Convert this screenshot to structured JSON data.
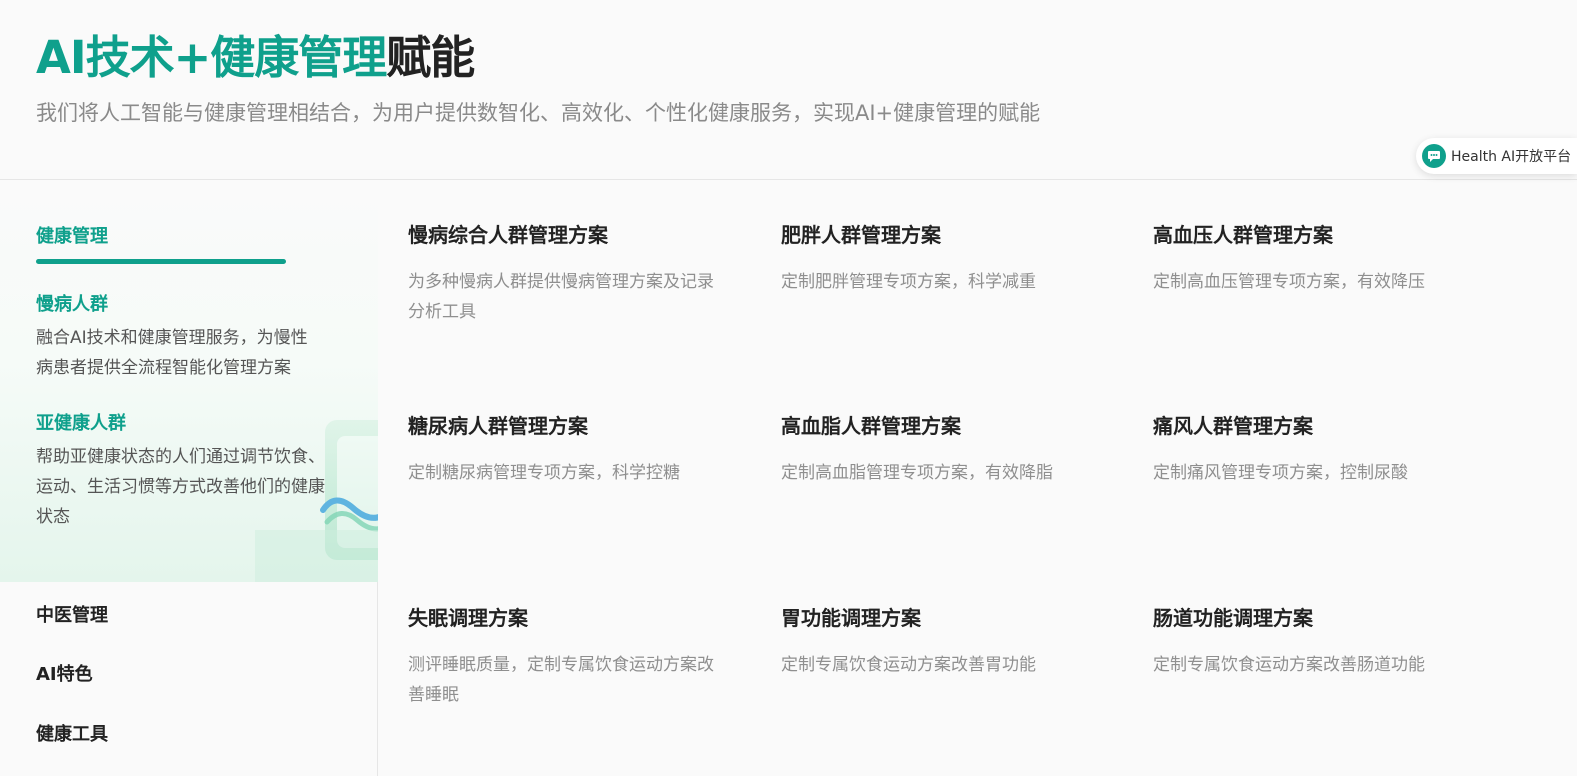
{
  "hero": {
    "title_accent": "AI技术+健康管理",
    "title_rest": "赋能",
    "subtitle": "我们将人工智能与健康管理相结合，为用户提供数智化、高效化、个性化健康服务，实现AI+健康管理的赋能"
  },
  "float_chip": {
    "label": "Health AI开放平台",
    "icon": "chat-bubble-icon"
  },
  "sidebar": {
    "active_section": "健康管理",
    "subsections": [
      {
        "title": "慢病人群",
        "desc": "融合AI技术和健康管理服务，为慢性病患者提供全流程智能化管理方案"
      },
      {
        "title": "亚健康人群",
        "desc": "帮助亚健康状态的人们通过调节饮食、运动、生活习惯等方式改善他们的健康状态"
      }
    ],
    "nav": [
      "中医管理",
      "AI特色",
      "健康工具"
    ]
  },
  "cards": [
    {
      "title": "慢病综合人群管理方案",
      "desc": "为多种慢病人群提供慢病管理方案及记录分析工具"
    },
    {
      "title": "肥胖人群管理方案",
      "desc": "定制肥胖管理专项方案，科学减重"
    },
    {
      "title": "高血压人群管理方案",
      "desc": "定制高血压管理专项方案，有效降压"
    },
    {
      "title": "糖尿病人群管理方案",
      "desc": "定制糖尿病管理专项方案，科学控糖"
    },
    {
      "title": "高血脂人群管理方案",
      "desc": "定制高血脂管理专项方案，有效降脂"
    },
    {
      "title": "痛风人群管理方案",
      "desc": "定制痛风管理专项方案，控制尿酸"
    },
    {
      "title": "失眠调理方案",
      "desc": "测评睡眠质量，定制专属饮食运动方案改善睡眠"
    },
    {
      "title": "胃功能调理方案",
      "desc": "定制专属饮食运动方案改善胃功能"
    },
    {
      "title": "肠道功能调理方案",
      "desc": "定制专属饮食运动方案改善肠道功能"
    }
  ],
  "colors": {
    "accent": "#0fa08c",
    "text_dark": "#222222",
    "text_muted": "#8f8f8f"
  }
}
